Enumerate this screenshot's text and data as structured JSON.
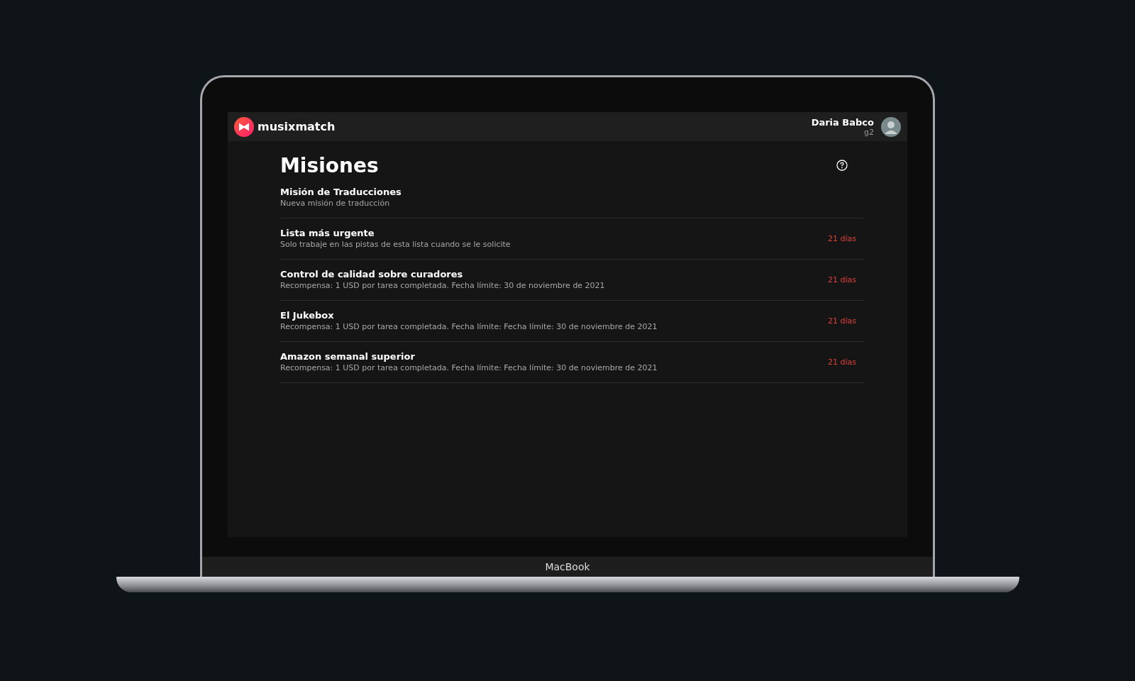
{
  "device": {
    "label": "MacBook"
  },
  "header": {
    "brand": "musixmatch",
    "user_name": "Daria Babco",
    "user_sub": "g2"
  },
  "page": {
    "title": "Misiones"
  },
  "missions": [
    {
      "title": "Misión de Traducciones",
      "subtitle": "Nueva misión de traducción"
    },
    {
      "title": "Lista más urgente",
      "subtitle": "Solo trabaje en las pistas de esta lista cuando se le solicite",
      "days": "21 días"
    },
    {
      "title": "Control de calidad sobre curadores",
      "subtitle": "Recompensa: 1 USD por tarea completada. Fecha límite: 30 de noviembre de 2021",
      "days": "21 días"
    },
    {
      "title": "El Jukebox",
      "subtitle": "Recompensa: 1 USD por tarea completada. Fecha límite: Fecha límite: 30 de noviembre de 2021",
      "days": "21 días"
    },
    {
      "title": "Amazon semanal superior",
      "subtitle": "Recompensa: 1 USD por tarea completada. Fecha límite: Fecha límite: 30 de noviembre de 2021",
      "days": "21 días"
    }
  ]
}
